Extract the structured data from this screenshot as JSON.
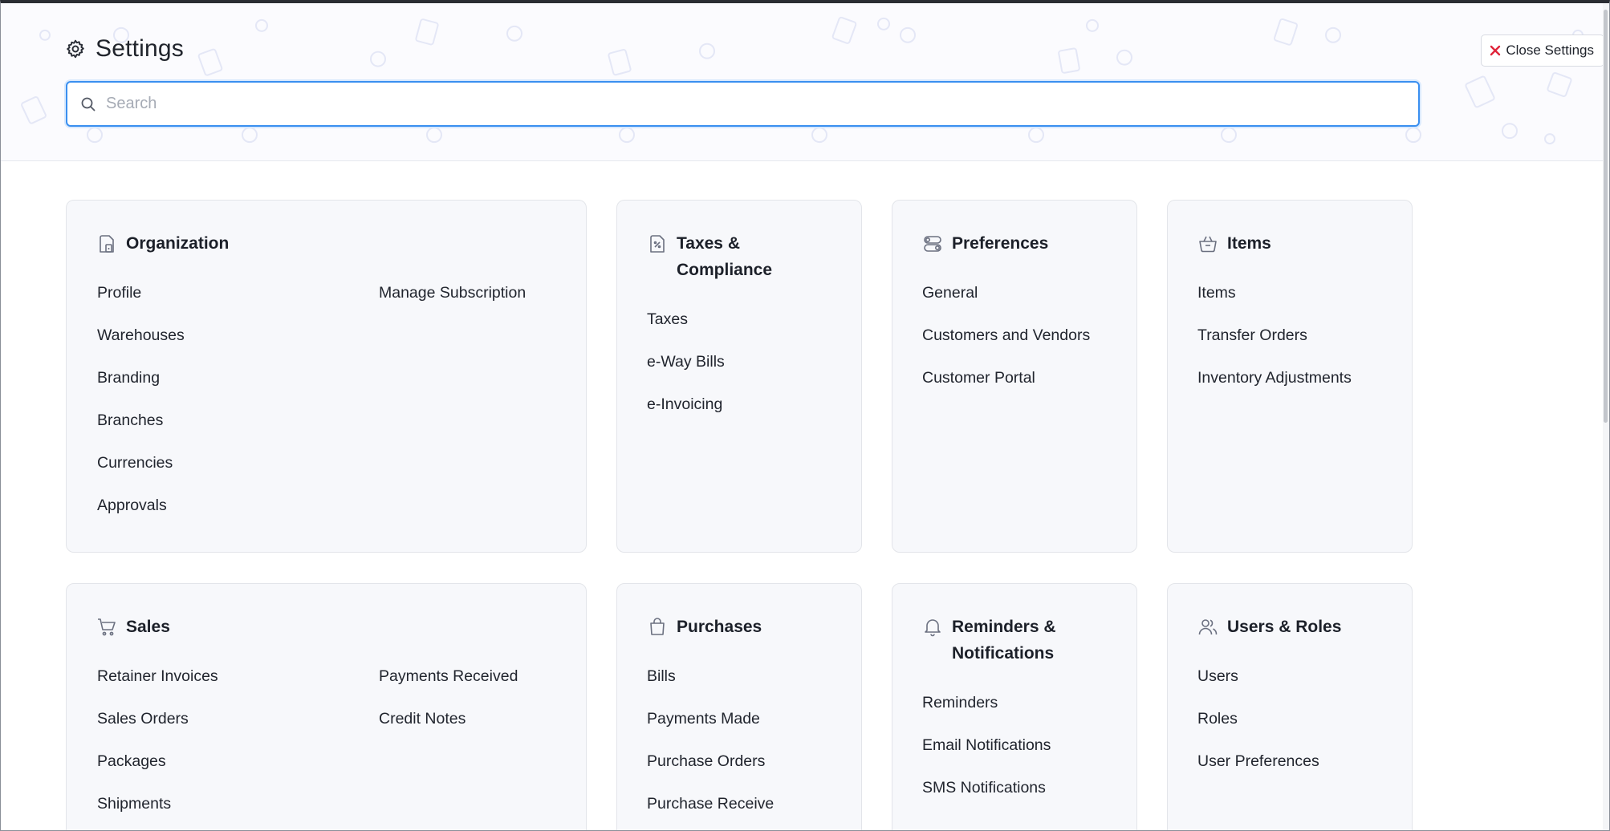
{
  "header": {
    "title": "Settings",
    "close_label": "Close Settings",
    "search_placeholder": "Search",
    "search_value": ""
  },
  "icons": {
    "settings": "gear-icon",
    "close": "close-icon",
    "search": "search-icon"
  },
  "colors": {
    "accent": "#3a8ff0",
    "close_x": "#e0243a",
    "card_bg": "#f7f8fb",
    "icon": "#6b7080"
  },
  "cards": {
    "organization": {
      "title": "Organization",
      "icon": "building-icon",
      "items": [
        "Profile",
        "Manage Subscription",
        "Warehouses",
        "Branding",
        "Branches",
        "Currencies",
        "Approvals"
      ]
    },
    "taxes": {
      "title_line1": "Taxes &",
      "title_line2": "Compliance",
      "icon": "tax-document-icon",
      "items": [
        "Taxes",
        "e-Way Bills",
        "e-Invoicing"
      ]
    },
    "preferences": {
      "title": "Preferences",
      "icon": "toggles-icon",
      "items": [
        "General",
        "Customers and Vendors",
        "Customer Portal"
      ]
    },
    "items": {
      "title": "Items",
      "icon": "basket-icon",
      "items": [
        "Items",
        "Transfer Orders",
        "Inventory Adjustments"
      ]
    },
    "sales": {
      "title": "Sales",
      "icon": "cart-icon",
      "items": [
        "Retainer Invoices",
        "Payments Received",
        "Sales Orders",
        "Credit Notes",
        "Packages",
        "Shipments"
      ]
    },
    "purchases": {
      "title": "Purchases",
      "icon": "shopping-bag-icon",
      "items": [
        "Bills",
        "Payments Made",
        "Purchase Orders",
        "Purchase Receive"
      ]
    },
    "reminders": {
      "title_line1": "Reminders &",
      "title_line2": "Notifications",
      "icon": "bell-icon",
      "items": [
        "Reminders",
        "Email Notifications",
        "SMS Notifications"
      ]
    },
    "users": {
      "title": "Users & Roles",
      "icon": "users-icon",
      "items": [
        "Users",
        "Roles",
        "User Preferences"
      ]
    }
  }
}
